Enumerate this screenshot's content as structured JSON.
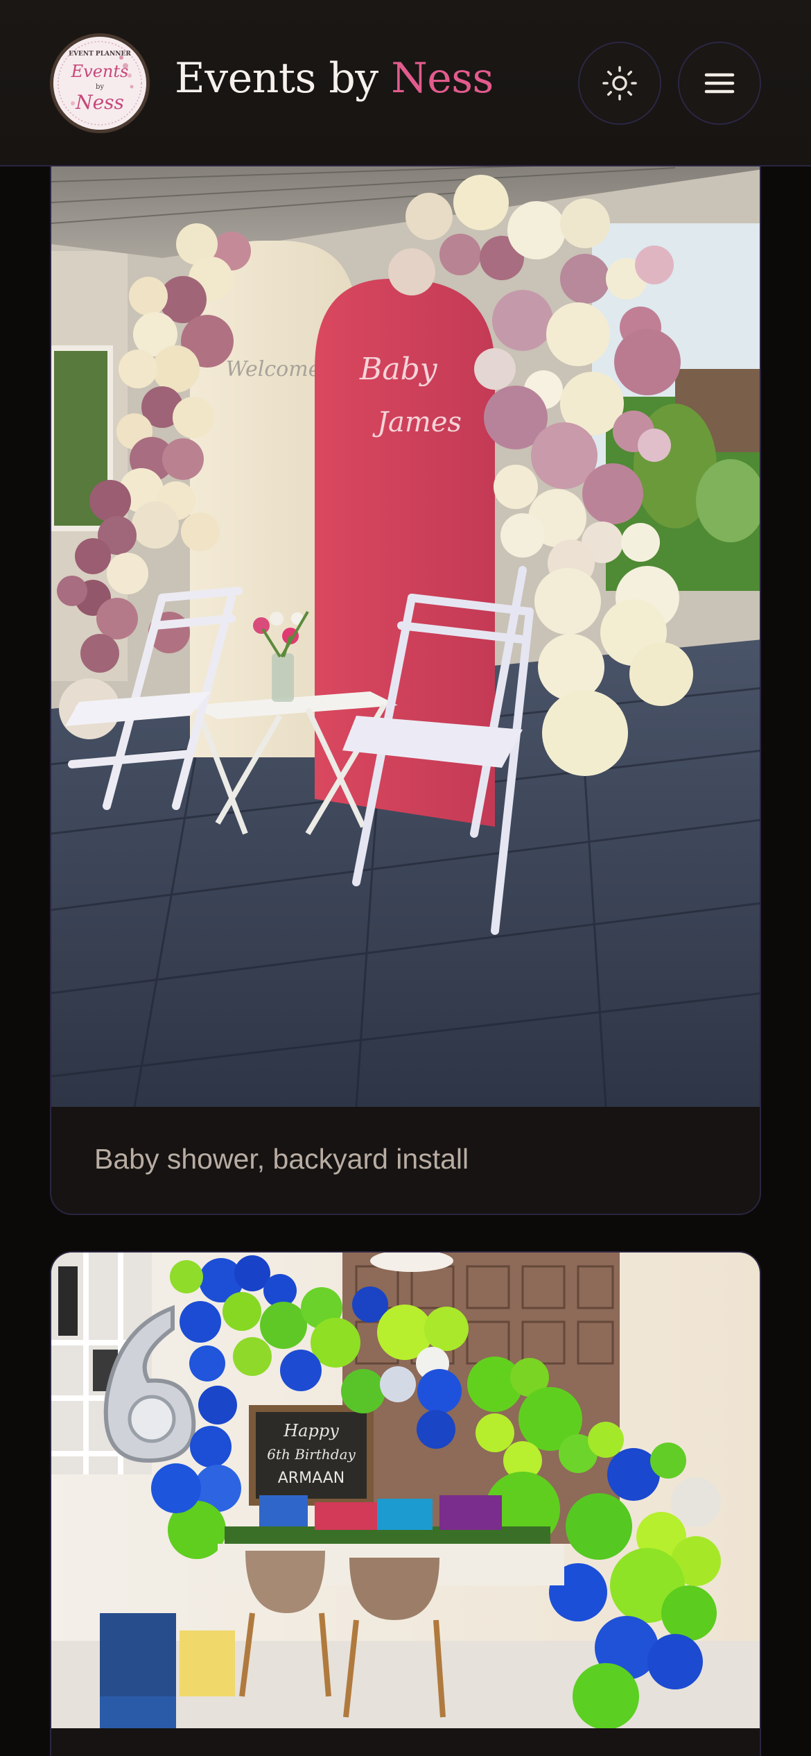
{
  "header": {
    "brand_main": "Events by ",
    "brand_accent": "Ness",
    "logo_alt": "Events by Ness event planner logo",
    "logo_text": [
      "EVENT PLANNER",
      "Events",
      "by",
      "Ness"
    ],
    "theme_toggle_icon": "sun-icon",
    "menu_icon": "hamburger-menu-icon"
  },
  "gallery": {
    "items": [
      {
        "caption": "Baby shower, backyard install",
        "photo": "arch-backdrop-photo",
        "arch_text": [
          "Welcome",
          "Baby",
          "James"
        ]
      },
      {
        "caption": "",
        "photo": "birthday-balloon-photo",
        "chalkboard_text": [
          "Happy",
          "6th Birthday",
          "ARMAAN"
        ]
      }
    ]
  },
  "colors": {
    "background": "#0c0a09",
    "header": "#171412",
    "card": "#161312",
    "border": "#2a2540",
    "accent": "#e25b8d",
    "brand_text": "#f6f1ec",
    "caption_text": "#b9ada3"
  }
}
